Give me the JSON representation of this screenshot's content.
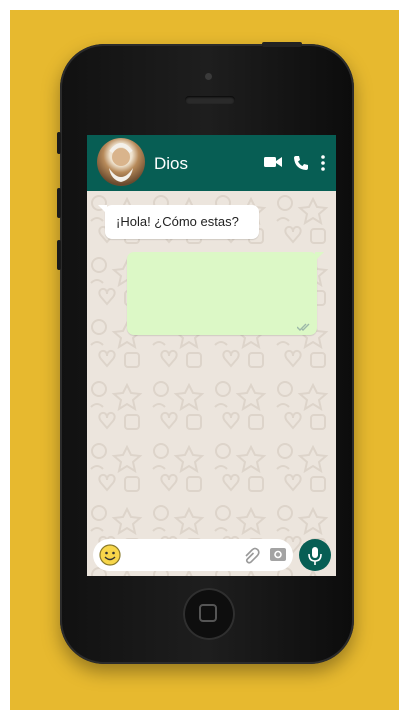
{
  "chat": {
    "contact_name": "Dios",
    "messages": [
      {
        "direction": "incoming",
        "text": "¡Hola! ¿Cómo estas?"
      },
      {
        "direction": "outgoing",
        "text": "",
        "status": "delivered"
      }
    ]
  },
  "input": {
    "value": "",
    "placeholder": ""
  },
  "icons": {
    "header": [
      "video-call-icon",
      "voice-call-icon",
      "more-options-icon"
    ],
    "input_bar": [
      "emoji-icon",
      "attach-icon",
      "camera-icon",
      "mic-icon"
    ]
  },
  "colors": {
    "background": "#e7b92f",
    "header": "#075e54",
    "chat_background": "#ece5dd",
    "outgoing_bubble": "#dcf8c6",
    "incoming_bubble": "#ffffff"
  }
}
